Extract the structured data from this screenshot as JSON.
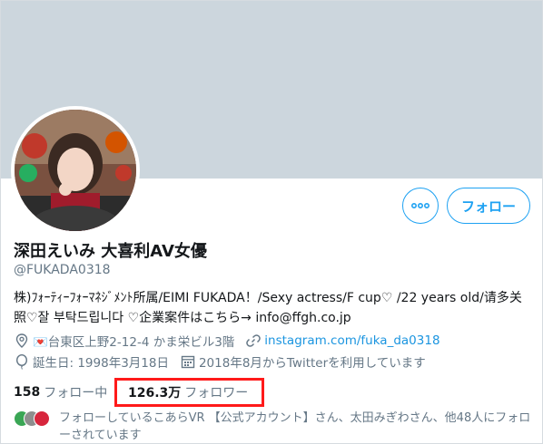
{
  "profile": {
    "display_name": "深田えいみ 大喜利AV女優",
    "handle": "@FUKADA0318",
    "bio_line1": "株)ﾌｫｰﾃｨｰﾌｫｰﾏﾈｼﾞﾒﾝﾄ所属/EIMI FUKADA！/Sexy actress/F cup♡ /22 years old/请多关",
    "bio_line2": "照♡잘 부탁드립니다 ♡企業案件はこちら→ info@ffgh.co.jp",
    "location": "💌台東区上野2-12-4 かま栄ビル3階",
    "website": "instagram.com/fuka_da0318",
    "birthday": "誕生日: 1998年3月18日",
    "joined": "2018年8月からTwitterを利用しています"
  },
  "actions": {
    "follow_label": "フォロー",
    "more_icon": "more-horizontal-icon"
  },
  "stats": {
    "following_count": "158",
    "following_label": "フォロー中",
    "followers_count": "126.3万",
    "followers_label": "フォロワー"
  },
  "mutual": {
    "text": "フォローしているこあらVR 【公式アカウント】さん、太田みぎわさん、他48人にフォローされています"
  },
  "icons": [
    "location-icon",
    "link-icon",
    "balloon-icon",
    "calendar-icon"
  ],
  "colors": {
    "accent": "#1da1f2",
    "link": "#1b95e0",
    "banner": "#ccd6dd",
    "highlight_box": "#ff1a1a",
    "muted_text": "#657786"
  }
}
